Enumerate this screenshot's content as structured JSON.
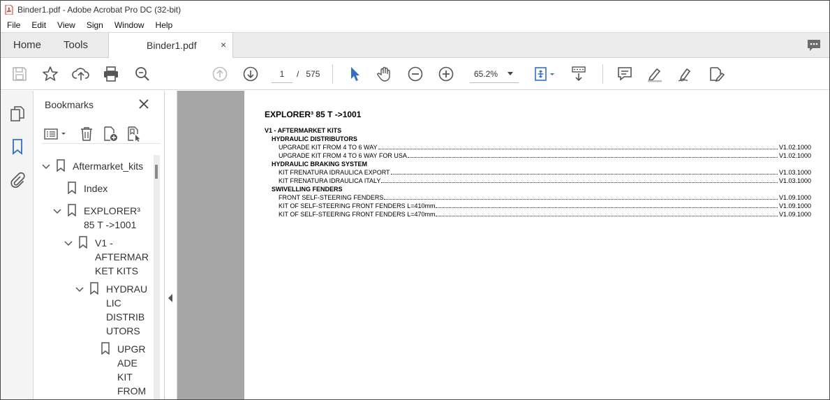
{
  "window": {
    "title": "Binder1.pdf - Adobe Acrobat Pro DC (32-bit)"
  },
  "menu": [
    "File",
    "Edit",
    "View",
    "Sign",
    "Window",
    "Help"
  ],
  "tabs": {
    "home": "Home",
    "tools": "Tools",
    "document": "Binder1.pdf",
    "close_glyph": "×"
  },
  "toolbar": {
    "current_page": "1",
    "page_separator": "/",
    "total_pages": "575",
    "zoom": "65.2%"
  },
  "bookmarks_panel": {
    "title": "Bookmarks",
    "tree": [
      {
        "label": "Aftermarket_kits"
      },
      {
        "label": "Index"
      },
      {
        "line1": "EXPLORER³",
        "line2": "85 T ->1001"
      },
      {
        "line1": "V1 -",
        "line2": "AFTERMAR",
        "line3": "KET KITS"
      },
      {
        "line1": "HYDRAU",
        "line2": "LIC",
        "line3": "DISTRIB",
        "line4": "UTORS"
      },
      {
        "line1": "UPGR",
        "line2": "ADE",
        "line3": "KIT",
        "line4": "FROM"
      }
    ]
  },
  "document": {
    "title": "EXPLORER³ 85 T ->1001",
    "section": "V1 - AFTERMARKET KITS",
    "groups": [
      {
        "heading": "HYDRAULIC DISTRIBUTORS",
        "entries": [
          {
            "text": "UPGRADE KIT FROM 4 TO 6 WAY",
            "page": "V1.02.1000"
          },
          {
            "text": "UPGRADE KIT FROM 4 TO 6 WAY FOR USA",
            "page": "V1.02.1000"
          }
        ]
      },
      {
        "heading": "HYDRAULIC BRAKING SYSTEM",
        "entries": [
          {
            "text": "KIT FRENATURA IDRAULICA EXPORT",
            "page": "V1.03.1000"
          },
          {
            "text": "KIT FRENATURA IDRAULICA ITALY",
            "page": "V1.03.1000"
          }
        ]
      },
      {
        "heading": "SWIVELLING FENDERS",
        "entries": [
          {
            "text": "FRONT SELF-STEERING FENDERS",
            "page": "V1.09.1000"
          },
          {
            "text": "KIT OF SELF-STEERING FRONT FENDERS L=410mm",
            "page": "V1.09.1000"
          },
          {
            "text": "KIT OF SELF-STEERING FRONT FENDERS L=470mm",
            "page": "V1.09.1000"
          }
        ]
      }
    ]
  },
  "colors": {
    "accent": "#2f6fcf",
    "pdf_red": "#d9261c",
    "gray_canvas": "#a6a6a6"
  }
}
